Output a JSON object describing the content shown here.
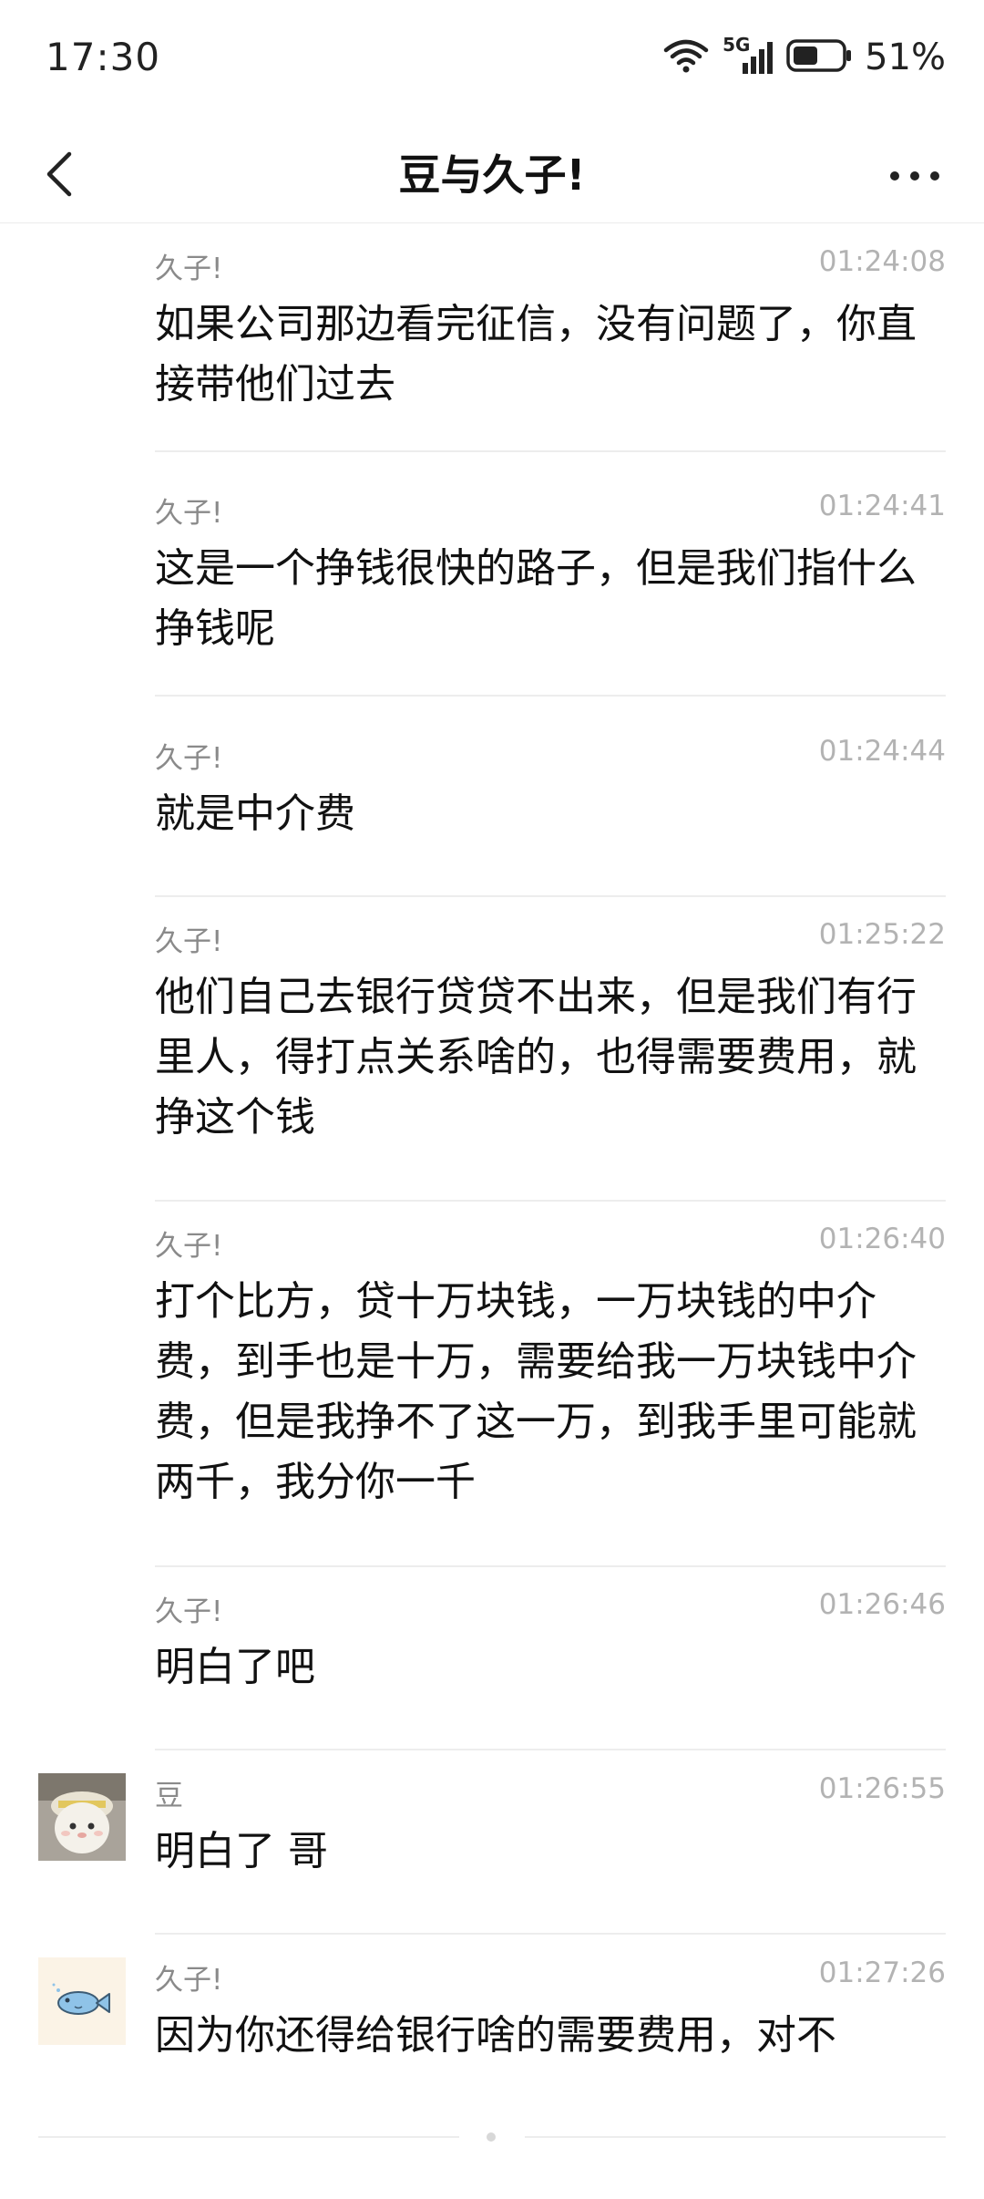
{
  "status_bar": {
    "time": "17:30",
    "network": "5G",
    "battery_percent": "51%",
    "battery_level": 0.51
  },
  "header": {
    "title": "豆与久子!"
  },
  "messages": [
    {
      "sender": "久子!",
      "time": "01:24:08",
      "text": "如果公司那边看完征信，没有问题了，你直接带他们过去"
    },
    {
      "sender": "久子!",
      "time": "01:24:41",
      "text": "这是一个挣钱很快的路子，但是我们指什么挣钱呢"
    },
    {
      "sender": "久子!",
      "time": "01:24:44",
      "text": "就是中介费"
    },
    {
      "sender": "久子!",
      "time": "01:25:22",
      "text": "他们自己去银行贷贷不出来，但是我们有行里人，得打点关系啥的，也得需要费用，就挣这个钱"
    },
    {
      "sender": "久子!",
      "time": "01:26:40",
      "text": "打个比方，贷十万块钱，一万块钱的中介费，到手也是十万，需要给我一万块钱中介费，但是我挣不了这一万，到我手里可能就两千，我分你一千"
    },
    {
      "sender": "久子!",
      "time": "01:26:46",
      "text": "明白了吧"
    },
    {
      "sender": "豆",
      "time": "01:26:55",
      "text": "明白了 哥"
    },
    {
      "sender": "久子!",
      "time": "01:27:26",
      "text": "因为你还得给银行啥的需要费用，对不"
    }
  ],
  "colors": {
    "text_primary": "#111111",
    "text_secondary": "#8a8a8a",
    "timestamp": "#b3b3b3",
    "divider": "#ededed",
    "fish_avatar_bg": "#fbf3e6",
    "fish_color": "#8fc3e8"
  }
}
